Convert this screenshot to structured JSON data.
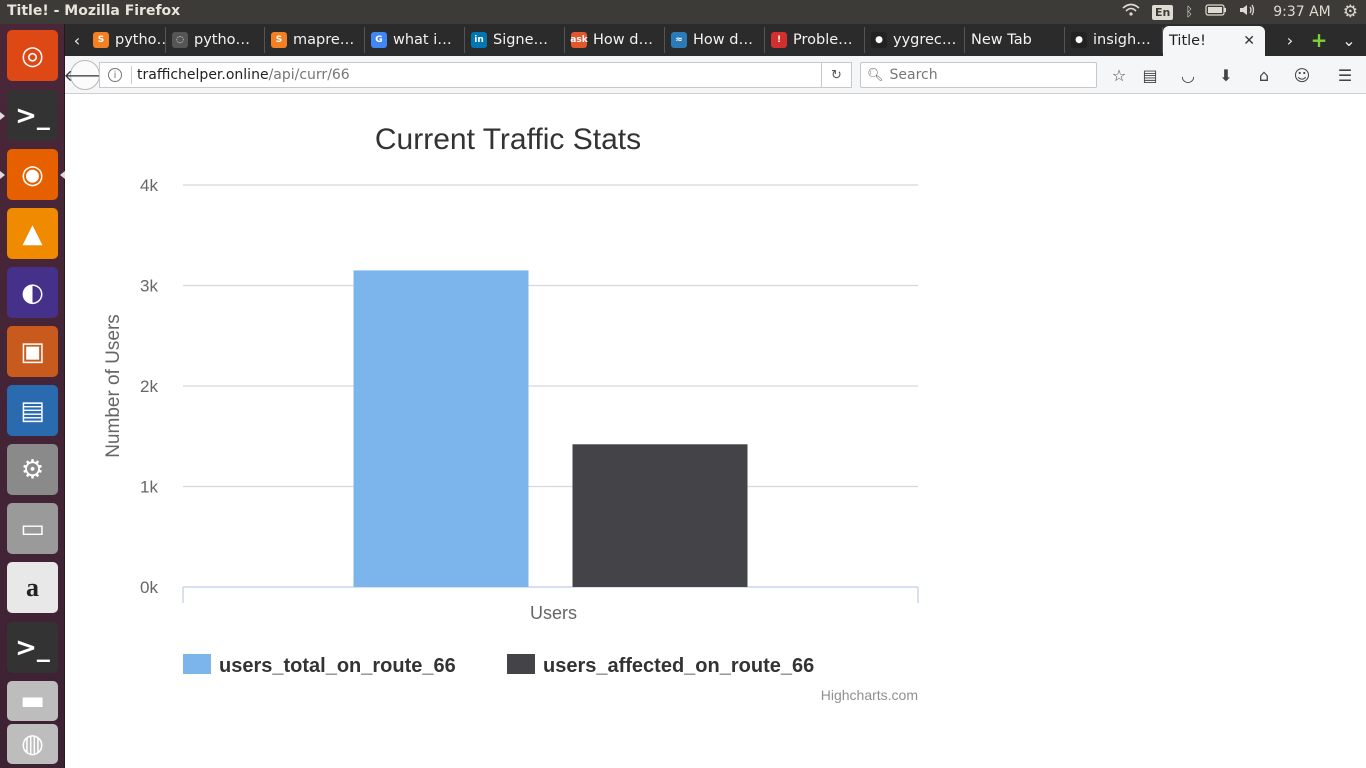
{
  "window": {
    "title": "Title! - Mozilla Firefox"
  },
  "system": {
    "keyboard_layout": "En",
    "clock": "9:37 AM"
  },
  "launcher": {
    "apps": [
      {
        "name": "ubuntu-dash",
        "glyph": "◎",
        "color": "#dd4814"
      },
      {
        "name": "terminal",
        "glyph": ">_",
        "color": "#333333"
      },
      {
        "name": "firefox",
        "glyph": "◉",
        "color": "#e66000"
      },
      {
        "name": "vlc",
        "glyph": "▲",
        "color": "#f08a00"
      },
      {
        "name": "eclipse",
        "glyph": "◐",
        "color": "#45308a"
      },
      {
        "name": "libreoffice-impress",
        "glyph": "▣",
        "color": "#c85a1e"
      },
      {
        "name": "libreoffice-writer",
        "glyph": "▤",
        "color": "#2a6bb0"
      },
      {
        "name": "system-settings",
        "glyph": "⚙",
        "color": "#8a8a8a"
      },
      {
        "name": "file-manager",
        "glyph": "▭",
        "color": "#9a9a9a"
      },
      {
        "name": "amazon",
        "glyph": "a",
        "color": "#e8e8e8"
      },
      {
        "name": "terminal-2",
        "glyph": ">_",
        "color": "#333333"
      },
      {
        "name": "disk-drive",
        "glyph": "▬",
        "color": "#bdbdbd"
      },
      {
        "name": "optical-drive",
        "glyph": "◍",
        "color": "#bdbdbd"
      }
    ]
  },
  "tabs": [
    {
      "label": "pytho…",
      "fav": "S",
      "favcolor": "#f48024"
    },
    {
      "label": "pytho…",
      "fav": "◌",
      "favcolor": "#555555"
    },
    {
      "label": "mapre…",
      "fav": "S",
      "favcolor": "#f48024"
    },
    {
      "label": "what i…",
      "fav": "G",
      "favcolor": "#4285f4"
    },
    {
      "label": "Signe…",
      "fav": "in",
      "favcolor": "#0077b5"
    },
    {
      "label": "How d…",
      "fav": "ask",
      "favcolor": "#e4572e"
    },
    {
      "label": "How d…",
      "fav": "≈",
      "favcolor": "#2b7bb9"
    },
    {
      "label": "Proble…",
      "fav": "!",
      "favcolor": "#d32f2f"
    },
    {
      "label": "yygrec…",
      "fav": "●",
      "favcolor": "#222222"
    },
    {
      "label": "New Tab",
      "fav": "",
      "favcolor": ""
    },
    {
      "label": "insigh…",
      "fav": "●",
      "favcolor": "#222222"
    },
    {
      "label": "Title!",
      "fav": "",
      "favcolor": "",
      "active": true
    }
  ],
  "navbar": {
    "url_host": "traffichelper.online",
    "url_path": "/api/curr/66",
    "search_placeholder": "Search"
  },
  "chart_data": {
    "type": "bar",
    "title": "Current Traffic Stats",
    "xlabel": "",
    "ylabel": "Number of Users",
    "categories": [
      "Users"
    ],
    "series": [
      {
        "name": "users_total_on_route_66",
        "values": [
          3150
        ],
        "color": "#7cb5ec"
      },
      {
        "name": "users_affected_on_route_66",
        "values": [
          1420
        ],
        "color": "#434348"
      }
    ],
    "ylim": [
      0,
      4000
    ],
    "yticks": [
      0,
      1000,
      2000,
      3000,
      4000
    ],
    "ytick_labels": [
      "0k",
      "1k",
      "2k",
      "3k",
      "4k"
    ],
    "grid": true,
    "legend": "bottom",
    "credit": "Highcharts.com"
  }
}
